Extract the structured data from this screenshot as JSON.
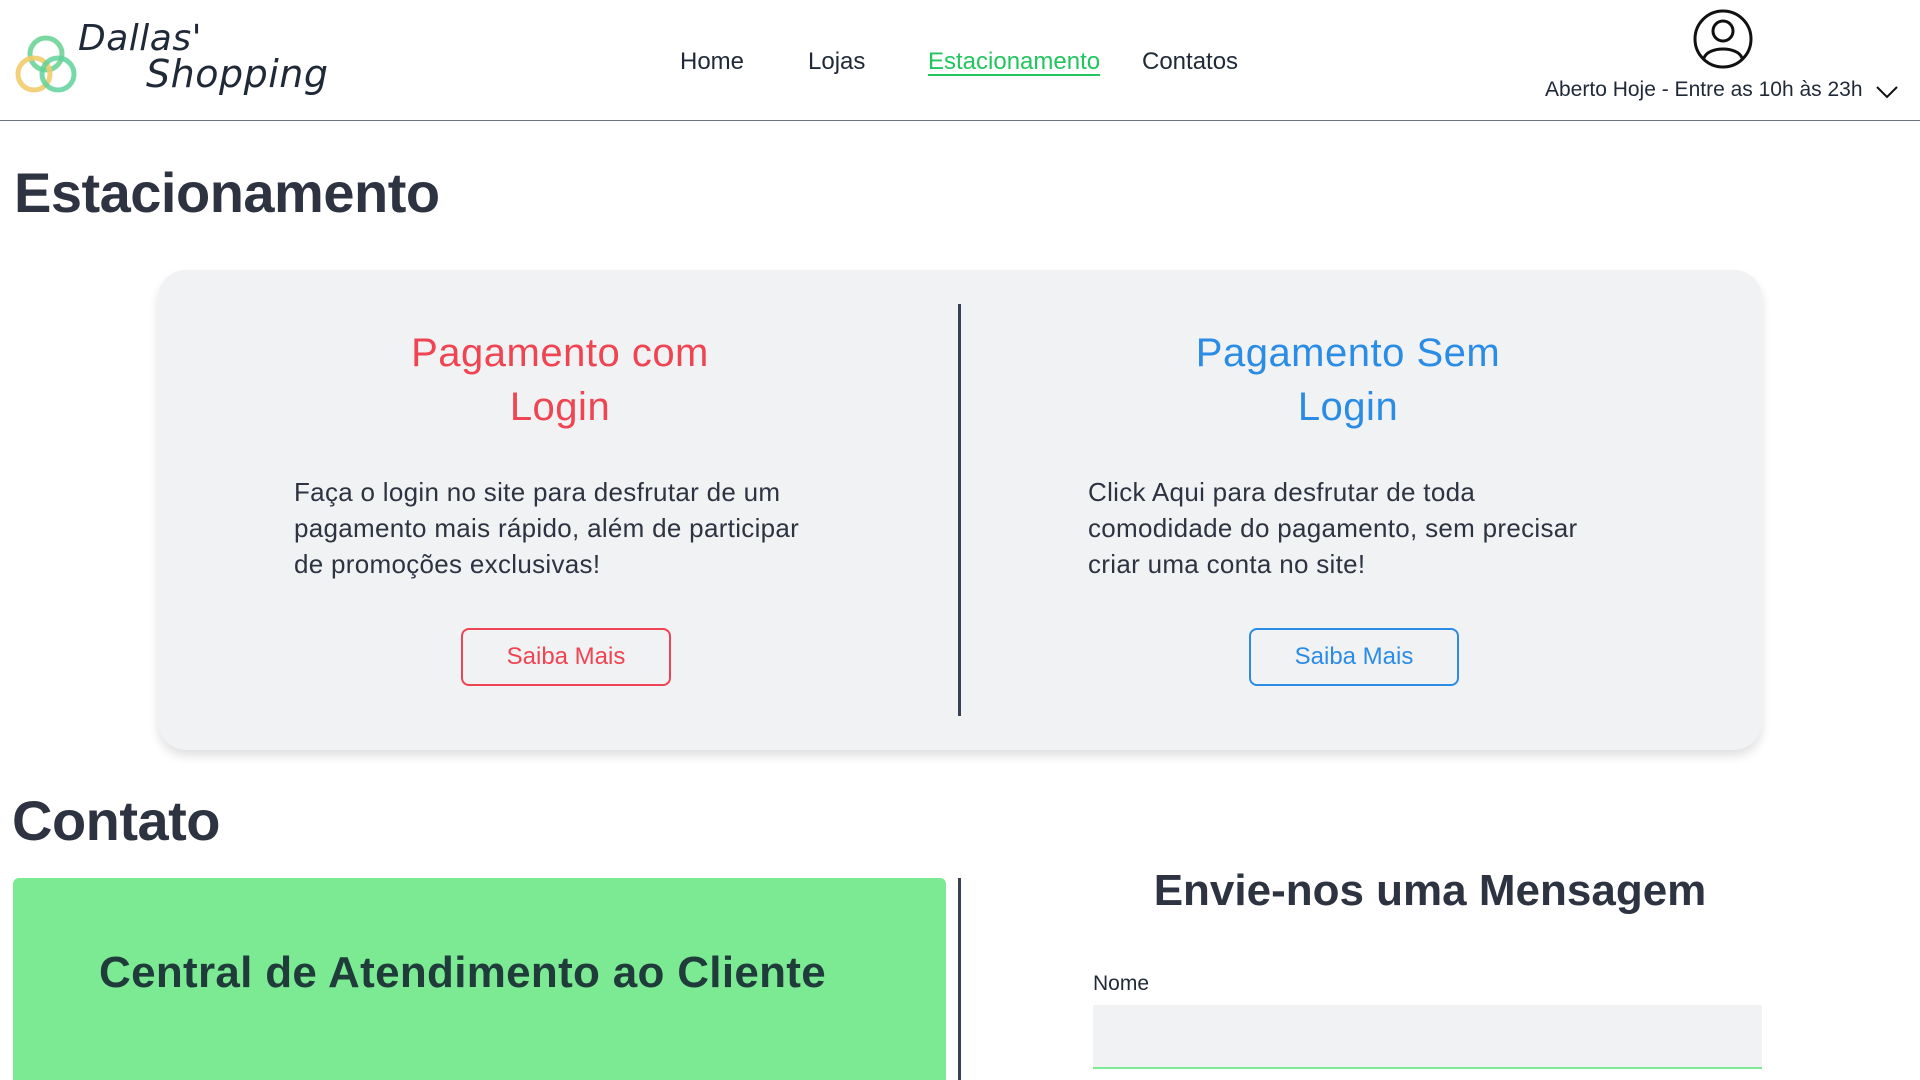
{
  "header": {
    "brand_line1": "Dallas'",
    "brand_line2": "Shopping",
    "nav": [
      {
        "label": "Home",
        "active": false
      },
      {
        "label": "Lojas",
        "active": false
      },
      {
        "label": "Estacionamento",
        "active": true
      },
      {
        "label": "Contatos",
        "active": false
      }
    ],
    "hours": "Aberto Hoje - Entre as 10h às 23h",
    "icons": {
      "logo": "triquetra-logo-icon",
      "user": "user-account-icon",
      "dropdown": "chevron-down-icon"
    }
  },
  "parking": {
    "title": "Estacionamento",
    "with_login": {
      "title_line1": "Pagamento com",
      "title_line2": "Login",
      "text_lines": [
        "Faça o login no site para desfrutar de um",
        "pagamento mais rápido, além de participar",
        "de promoções exclusivas!"
      ],
      "button": "Saiba Mais",
      "color": "#ef4452"
    },
    "without_login": {
      "title_line1": "Pagamento Sem",
      "title_line2": "Login",
      "text_lines": [
        "Click Aqui para desfrutar de toda",
        "comodidade do pagamento, sem precisar",
        "criar uma conta no site!"
      ],
      "button": "Saiba Mais",
      "color": "#2b8ce6"
    }
  },
  "contact": {
    "title": "Contato",
    "support_title": "Central de Atendimento ao Cliente",
    "support_color": "#7bea93",
    "form": {
      "title": "Envie-nos uma Mensagem",
      "name_label": "Nome",
      "name_value": ""
    }
  },
  "colors": {
    "accent_green": "#22c55e",
    "text_dark": "#2d3340",
    "card_bg": "#f1f2f4"
  }
}
